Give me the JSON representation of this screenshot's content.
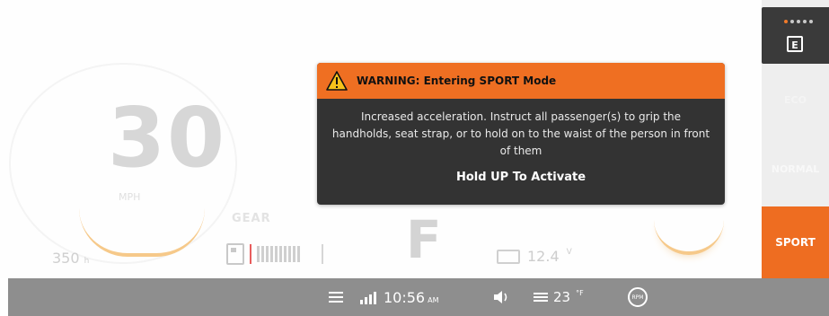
{
  "cluster": {
    "speed": "30",
    "speed_unit": "MPH",
    "gear_label": "GEAR",
    "gear": "F",
    "odometer": "350",
    "odometer_unit": "h",
    "battery_voltage": "12.4",
    "battery_unit": "V"
  },
  "warning": {
    "title": "WARNING: Entering SPORT Mode",
    "message": "Increased acceleration. Instruct all passenger(s) to grip the handholds, seat strap, or to hold on to the waist of the person in front of them",
    "action": "Hold UP To Activate",
    "accent_color": "#ef6f22"
  },
  "modes": {
    "current_icon": "E",
    "items": [
      "ECO",
      "NORMAL",
      "SPORT"
    ],
    "selected": "SPORT",
    "selected_color": "#ee6d21"
  },
  "status_bar": {
    "time": "10:56",
    "time_suffix": "AM",
    "temperature": "23",
    "temperature_unit": "°F",
    "circle_icon_label": "RPM"
  },
  "icons": [
    "warning-triangle-icon",
    "fuel-pump-icon",
    "battery-icon",
    "headlight-icon",
    "signal-icon",
    "volume-icon",
    "temperature-icon",
    "drive-icon",
    "menu-grid-icon"
  ]
}
